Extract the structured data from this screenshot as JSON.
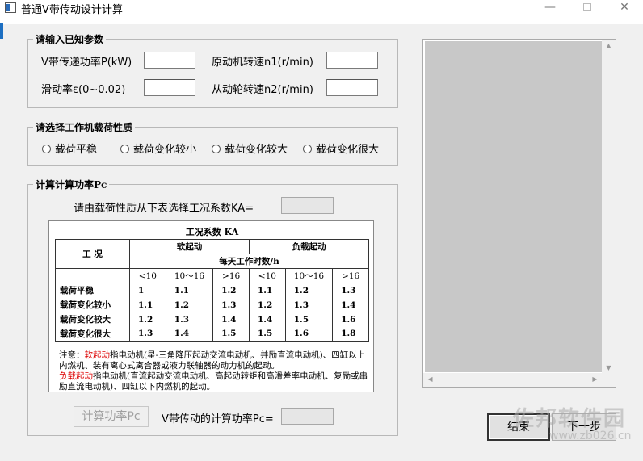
{
  "window": {
    "title": "普通V带传动设计计算",
    "minimize_glyph": "—",
    "close_glyph": "✕"
  },
  "known_params": {
    "legend": "请输入已知参数",
    "power_label": "V带传递功率P(kW)",
    "power_value": "",
    "motor_speed_label": "原动机转速n1(r/min)",
    "motor_speed_value": "",
    "slip_label": "滑动率ε(0~0.02)",
    "slip_value": "",
    "driven_speed_label": "从动轮转速n2(r/min)",
    "driven_speed_value": ""
  },
  "load_type": {
    "legend": "请选择工作机载荷性质",
    "options": [
      "载荷平稳",
      "载荷变化较小",
      "载荷变化较大",
      "载荷变化很大"
    ]
  },
  "calc_power": {
    "legend": "计算计算功率Pc",
    "ka_prompt": "请由载荷性质从下表选择工况系数KA=",
    "ka_value": "",
    "calc_button": "计算功率Pc",
    "result_label": "V带传动的计算功率Pc=",
    "result_value": ""
  },
  "ka_table": {
    "caption": "工况系数 KA",
    "condition_header": "工 况",
    "soft_start": "软起动",
    "load_start": "负载起动",
    "hours_header": "每天工作时数/h",
    "hour_ranges": [
      "<10",
      "10～16",
      ">16",
      "<10",
      "10～16",
      ">16"
    ],
    "rows": [
      {
        "name": "载荷平稳",
        "values": [
          "1",
          "1.1",
          "1.2",
          "1.1",
          "1.2",
          "1.3"
        ]
      },
      {
        "name": "载荷变化较小",
        "values": [
          "1.1",
          "1.2",
          "1.3",
          "1.2",
          "1.3",
          "1.4"
        ]
      },
      {
        "name": "载荷变化较大",
        "values": [
          "1.2",
          "1.3",
          "1.4",
          "1.4",
          "1.5",
          "1.6"
        ]
      },
      {
        "name": "载荷变化很大",
        "values": [
          "1.3",
          "1.4",
          "1.5",
          "1.5",
          "1.6",
          "1.8"
        ]
      }
    ],
    "note_prefix": "注意：",
    "note_soft": "软起动",
    "note_soft_text": "指电动机(星-三角降压起动交流电动机、并励直流电动机)、四缸以上内燃机、装有离心式离合器或液力联轴器的动力机的起动。",
    "note_load": "负载起动",
    "note_load_text": "指电动机(直流起动交流电动机、高起动转矩和高滑差率电动机、复励或串励直流电动机)、四缸以下内燃机的起动。"
  },
  "footer": {
    "finish_button": "结束",
    "next_button": "下一步"
  },
  "watermark": {
    "text": "佐邦软件园",
    "url": "www.zb026.cn"
  },
  "colors": {
    "window_bg": "#f0f0f0",
    "accent_strip": "#1d6fc2",
    "listbox_fill": "#c8c8c8",
    "note_highlight": "#dd0000"
  }
}
